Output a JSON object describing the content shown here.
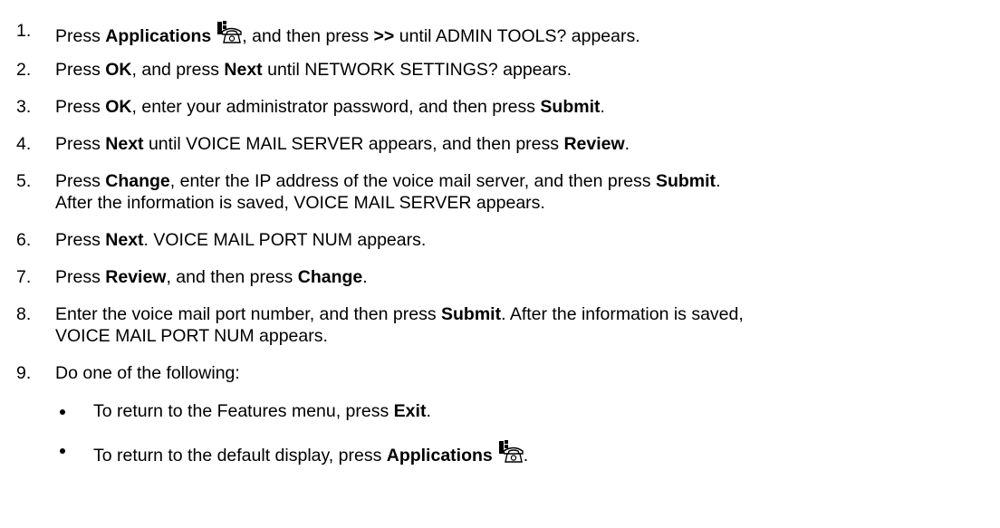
{
  "steps": [
    {
      "num": "1.",
      "a": "Press ",
      "b1": "Applications",
      "c": ", and then press ",
      "b2": ">>",
      "d": " until ADMIN TOOLS? appears."
    },
    {
      "num": "2.",
      "a": "Press ",
      "b1": "OK",
      "c": ", and press ",
      "b2": "Next",
      "d": " until NETWORK SETTINGS? appears."
    },
    {
      "num": "3.",
      "a": "Press ",
      "b1": "OK",
      "c": ", enter your administrator password, and then press ",
      "b2": "Submit",
      "d": "."
    },
    {
      "num": "4.",
      "a": "Press ",
      "b1": "Next",
      "c": " until VOICE MAIL SERVER appears, and then press ",
      "b2": "Review",
      "d": "."
    },
    {
      "num": "5.",
      "a": "Press ",
      "b1": "Change",
      "c": ", enter the IP address of the voice mail server, and then press ",
      "b2": "Submit",
      "d": ".",
      "line2": "After the information is saved, VOICE MAIL SERVER appears."
    },
    {
      "num": "6.",
      "a": "Press ",
      "b1": "Next",
      "c": ". VOICE MAIL PORT NUM appears."
    },
    {
      "num": "7.",
      "a": "Press ",
      "b1": "Review",
      "c": ", and then press ",
      "b2": "Change",
      "d": "."
    },
    {
      "num": "8.",
      "a": "Enter the voice mail port number, and then press ",
      "b1": "Submit",
      "c": ". After the information is saved,",
      "line2": "VOICE MAIL PORT NUM appears."
    },
    {
      "num": "9.",
      "a": "Do one of the following:"
    }
  ],
  "bullets": [
    {
      "a": "To return to the Features menu, press ",
      "b1": "Exit",
      "c": "."
    },
    {
      "a": "To return to the default display, press ",
      "b1": "Applications",
      "c": "."
    }
  ],
  "icons": {
    "applications": "phone-applications-icon"
  }
}
